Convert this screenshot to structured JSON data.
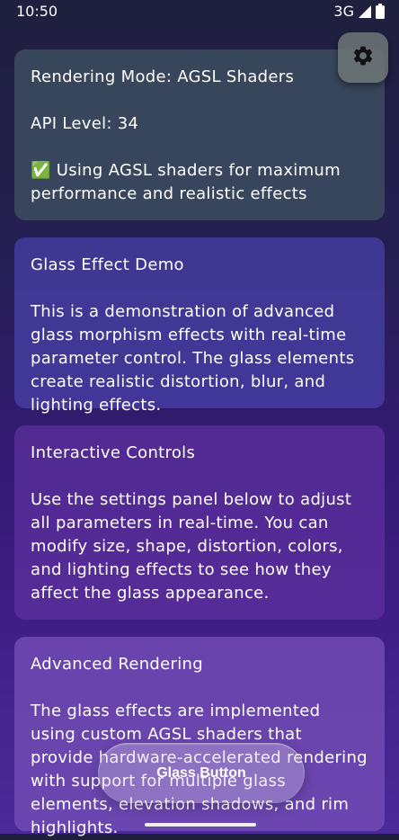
{
  "status_bar": {
    "time": "10:50",
    "network": "3G"
  },
  "cards": {
    "status": {
      "mode": "Rendering Mode: AGSL Shaders",
      "api": "API Level: 34",
      "note": "✅ Using AGSL shaders for maximum performance and realistic effects"
    },
    "demo": {
      "title": "Glass Effect Demo",
      "body": "This is a demonstration of advanced glass morphism effects with real-time parameter control. The glass elements create realistic distortion, blur, and lighting effects."
    },
    "controls": {
      "title": "Interactive Controls",
      "body": "Use the settings panel below to adjust all parameters in real-time. You can modify size, shape, distortion, colors, and lighting effects to see how they affect the glass appearance."
    },
    "advanced": {
      "title": "Advanced Rendering",
      "body": "The glass effects are implemented using custom AGSL shaders that provide hardware-accelerated rendering with support for multiple glass elements, elevation shadows, and rim highlights."
    }
  },
  "settings": {
    "icon": "gear-icon"
  },
  "glass_button": {
    "label": "Glass Button"
  },
  "colors": {
    "background_top": "#1f1f3e",
    "background_bottom": "#4c2a98",
    "status_card": "#3e5262",
    "demo_card": "#4a42aa",
    "controls_card": "#5e30a0",
    "advanced_card": "#7852ba"
  }
}
